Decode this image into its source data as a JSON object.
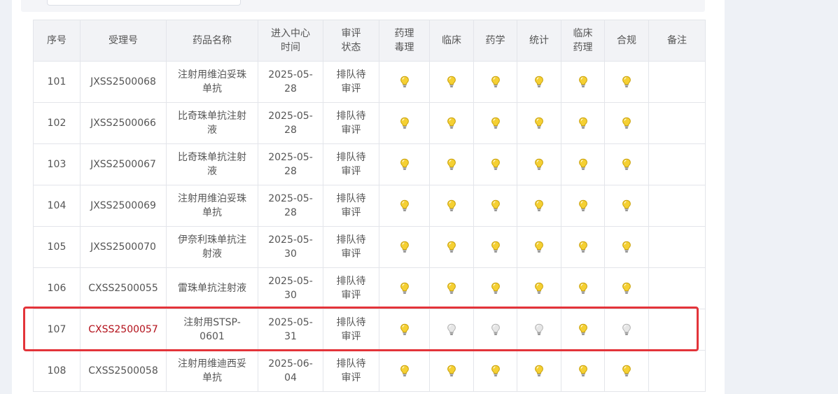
{
  "table": {
    "headers": [
      "序号",
      "受理号",
      "药品名称",
      "进入中心时间",
      "审评状态",
      "药理毒理",
      "临床",
      "药学",
      "统计",
      "临床药理",
      "合规",
      "备注"
    ],
    "rows": [
      {
        "seq": "101",
        "code": "JXSS2500068",
        "drug": "注射用维泊妥珠单抗",
        "date": "2025-05-28",
        "status": "排队待审评",
        "bulbs": [
          true,
          true,
          true,
          true,
          true,
          true
        ],
        "note": "",
        "highlighted": false
      },
      {
        "seq": "102",
        "code": "JXSS2500066",
        "drug": "比奇珠单抗注射液",
        "date": "2025-05-28",
        "status": "排队待审评",
        "bulbs": [
          true,
          true,
          true,
          true,
          true,
          true
        ],
        "note": "",
        "highlighted": false
      },
      {
        "seq": "103",
        "code": "JXSS2500067",
        "drug": "比奇珠单抗注射液",
        "date": "2025-05-28",
        "status": "排队待审评",
        "bulbs": [
          true,
          true,
          true,
          true,
          true,
          true
        ],
        "note": "",
        "highlighted": false
      },
      {
        "seq": "104",
        "code": "JXSS2500069",
        "drug": "注射用维泊妥珠单抗",
        "date": "2025-05-28",
        "status": "排队待审评",
        "bulbs": [
          true,
          true,
          true,
          true,
          true,
          true
        ],
        "note": "",
        "highlighted": false
      },
      {
        "seq": "105",
        "code": "JXSS2500070",
        "drug": "伊奈利珠单抗注射液",
        "date": "2025-05-30",
        "status": "排队待审评",
        "bulbs": [
          true,
          true,
          true,
          true,
          true,
          true
        ],
        "note": "",
        "highlighted": false
      },
      {
        "seq": "106",
        "code": "CXSS2500055",
        "drug": "雷珠单抗注射液",
        "date": "2025-05-30",
        "status": "排队待审评",
        "bulbs": [
          true,
          true,
          true,
          true,
          true,
          true
        ],
        "note": "",
        "highlighted": false
      },
      {
        "seq": "107",
        "code": "CXSS2500057",
        "drug": "注射用STSP-0601",
        "date": "2025-05-31",
        "status": "排队待审评",
        "bulbs": [
          true,
          false,
          false,
          false,
          true,
          false
        ],
        "note": "",
        "highlighted": true
      },
      {
        "seq": "108",
        "code": "CXSS2500058",
        "drug": "注射用维迪西妥单抗",
        "date": "2025-06-04",
        "status": "排队待审评",
        "bulbs": [
          true,
          true,
          true,
          true,
          true,
          true
        ],
        "note": "",
        "highlighted": false
      }
    ]
  },
  "colors": {
    "bulb_on": "#f5d033",
    "bulb_off": "#e6e6e6",
    "highlight_border": "#e3343a",
    "highlight_code": "#b3101a"
  },
  "icons": {
    "bulb_on": "lightbulb-on-icon",
    "bulb_off": "lightbulb-off-icon"
  }
}
